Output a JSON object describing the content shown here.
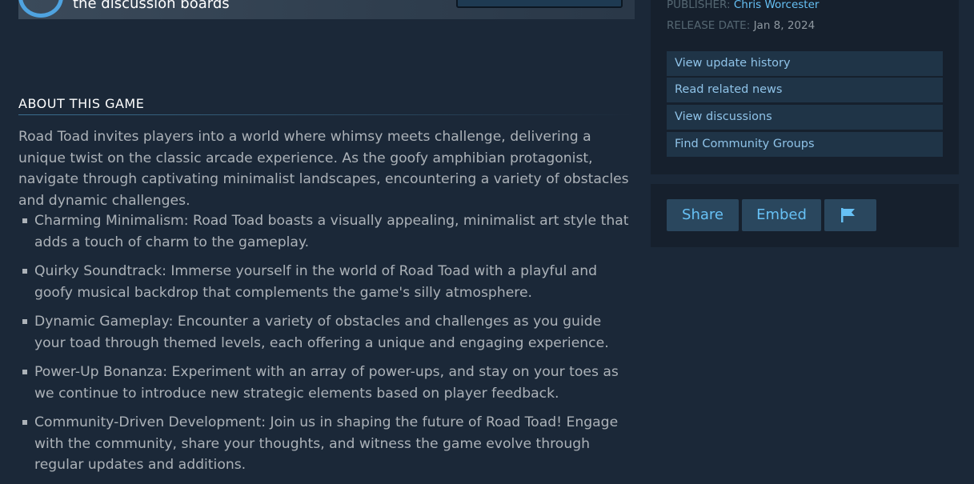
{
  "banner": {
    "text": "the discussion boards",
    "icon": "discussion-icon"
  },
  "about": {
    "heading": "ABOUT THIS GAME",
    "intro": "Road Toad invites players into a world where whimsy meets challenge, delivering a unique twist on the classic arcade experience. As the goofy amphibian protagonist, navigate through captivating minimalist landscapes, encountering a variety of obstacles and dynamic challenges.",
    "features": [
      "Charming Minimalism: Road Toad boasts a visually appealing, minimalist art style that adds a touch of charm to the gameplay.",
      "Quirky Soundtrack: Immerse yourself in the world of Road Toad with a playful and goofy musical backdrop that complements the game's silly atmosphere.",
      "Dynamic Gameplay: Encounter a variety of obstacles and challenges as you guide your toad through themed levels, each offering a unique and engaging experience.",
      "Power-Up Bonanza: Experiment with an array of power-ups, and stay on your toes as we continue to introduce new strategic elements based on player feedback.",
      "Community-Driven Development: Join us in shaping the future of Road Toad! Engage with the community, share your thoughts, and witness the game evolve through regular updates and additions."
    ]
  },
  "info": {
    "publisher_label": "PUBLISHER:",
    "publisher": "Chris Worcester",
    "release_label": "RELEASE DATE:",
    "release_date": "Jan 8, 2024",
    "links": [
      "View update history",
      "Read related news",
      "View discussions",
      "Find Community Groups"
    ]
  },
  "share": {
    "share_label": "Share",
    "embed_label": "Embed",
    "report_icon": "flag-icon"
  },
  "colors": {
    "background": "#1b2838",
    "panel": "#16202d",
    "link": "#66c0f4",
    "button": "#2a475e"
  }
}
